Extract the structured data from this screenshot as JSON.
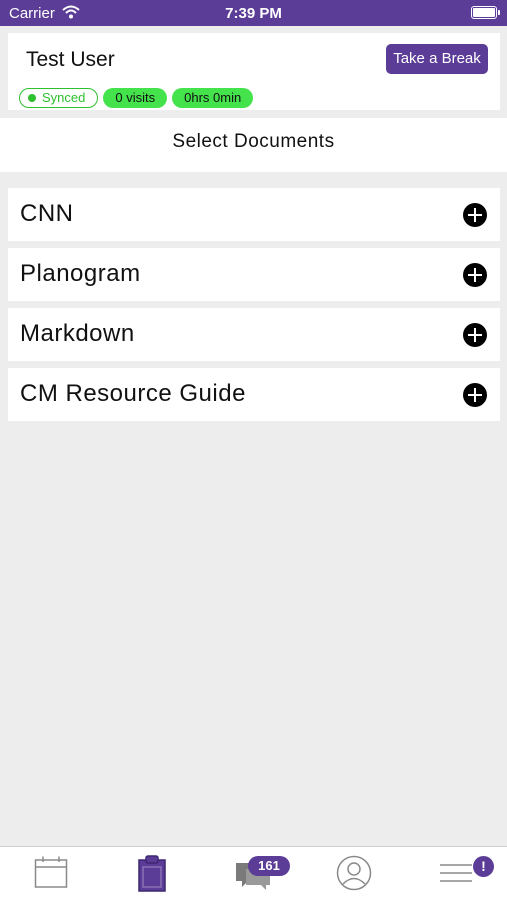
{
  "status_bar": {
    "carrier": "Carrier",
    "time": "7:39 PM"
  },
  "header": {
    "user_name": "Test User",
    "break_button": "Take a Break",
    "badges": {
      "synced": "Synced",
      "visits": "0 visits",
      "duration": "0hrs 0min"
    }
  },
  "section_title": "Select Documents",
  "documents": [
    {
      "label": "CNN"
    },
    {
      "label": "Planogram"
    },
    {
      "label": "Markdown"
    },
    {
      "label": "CM Resource Guide"
    }
  ],
  "tab_bar": {
    "tabs": [
      "calendar-icon",
      "clipboard-icon",
      "chat-bubbles-icon",
      "profile-icon",
      "menu-icon"
    ],
    "active_tab": "clipboard-icon",
    "message_count": "161",
    "menu_alert": "!"
  },
  "colors": {
    "accent": "#5b3c97",
    "status_green": "#44e34b",
    "synced_green": "#2fc02f"
  }
}
